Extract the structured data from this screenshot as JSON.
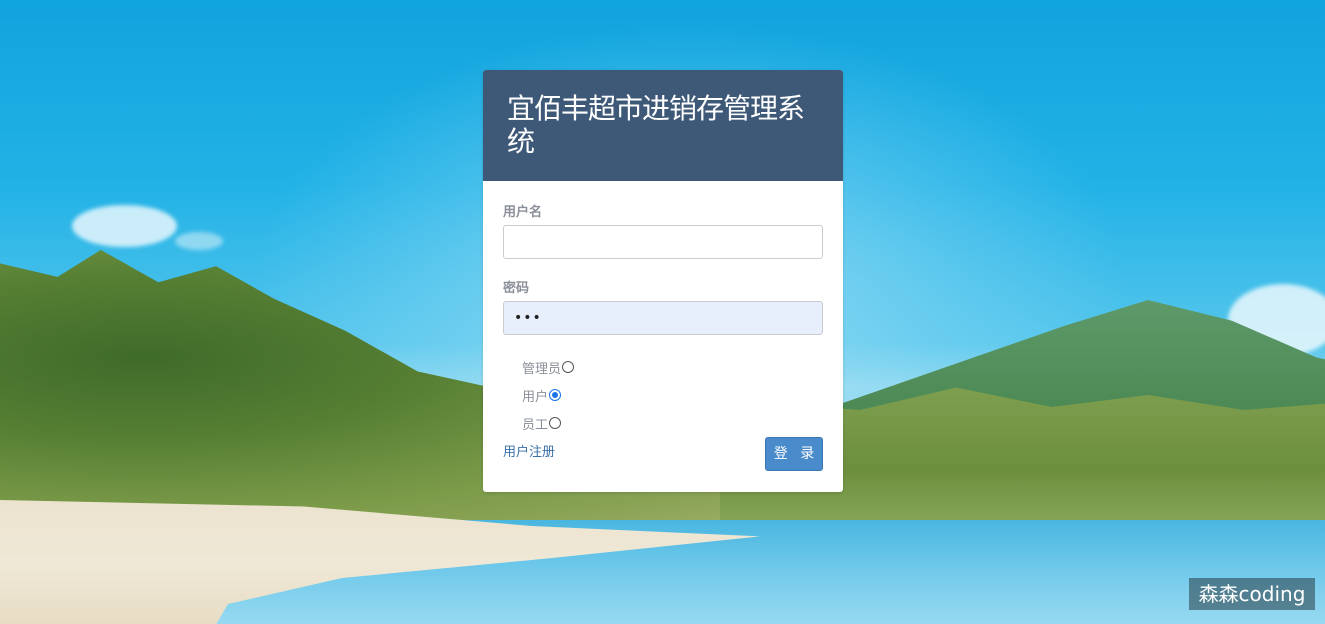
{
  "login": {
    "title": "宜佰丰超市进销存管理系统",
    "username_label": "用户名",
    "username_value": "",
    "password_label": "密码",
    "password_value": "•••",
    "roles": [
      {
        "label": "管理员",
        "checked": false
      },
      {
        "label": "用户",
        "checked": true
      },
      {
        "label": "员工",
        "checked": false
      }
    ],
    "register_link": "用户注册",
    "login_button": "登 录"
  },
  "watermark": "森森coding",
  "colors": {
    "header_bg": "#3e5878",
    "button_bg": "#4a8bcb",
    "link": "#3a6fa8",
    "password_field_bg": "#e8effc"
  }
}
